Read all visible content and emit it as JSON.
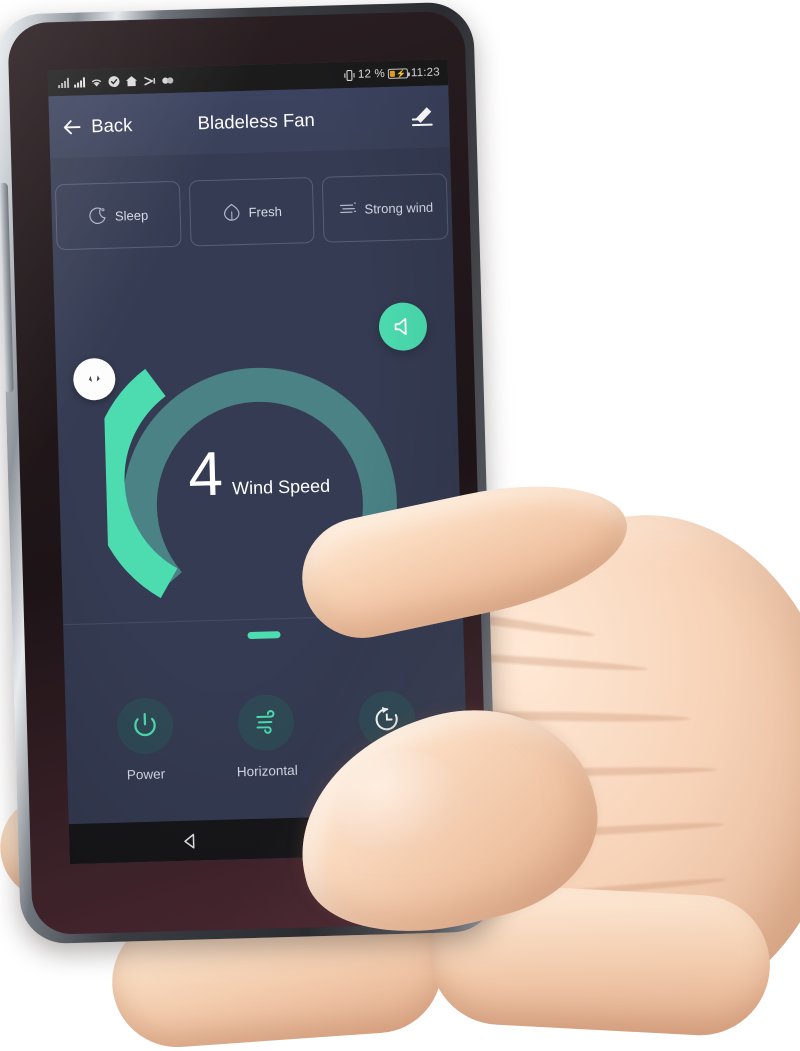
{
  "statusbar": {
    "signal_icon_1": "signal-bars-icon",
    "signal_icon_2": "signal-bars-icon",
    "wifi_icon": "wifi-icon",
    "vpn_icon": "shield-check-icon",
    "home_icon": "home-icon",
    "sync_icon": "sync-arrow-icon",
    "link_icon": "link-icon",
    "vibrate_icon": "vibrate-icon",
    "battery_percent": "12 %",
    "battery_icon": "battery-charging-icon",
    "clock": "11:23"
  },
  "appbar": {
    "back_icon": "arrow-left-icon",
    "back_label": "Back",
    "title": "Bladeless Fan",
    "edit_icon": "pencil-edit-icon"
  },
  "modes": [
    {
      "label": "Sleep",
      "icon": "moon-icon",
      "active": false
    },
    {
      "label": "Fresh",
      "icon": "leaf-icon",
      "active": false
    },
    {
      "label": "Strong wind",
      "icon": "wind-lines-icon",
      "active": false
    }
  ],
  "dial": {
    "value": "4",
    "label": "Wind Speed",
    "min": 1,
    "max": 9,
    "percent_filled": 38,
    "handle_icon": "drag-arrows-icon",
    "track_color": "#4a8285",
    "active_color": "#4cdcb0",
    "speaker_button": {
      "icon": "speaker-mute-icon",
      "color": "#4cdcb0"
    }
  },
  "indicator_pill": {
    "name": "page-indicator",
    "color": "#4cdcb0"
  },
  "controls": [
    {
      "label": "Power",
      "icon": "power-icon",
      "icon_color": "#4cdcb0",
      "active": true
    },
    {
      "label": "Horizontal",
      "icon": "wind-swirl-icon",
      "icon_color": "#4cdcb0",
      "active": true
    },
    {
      "label": "",
      "icon": "timer-clock-icon",
      "icon_color": "#ffffff",
      "active": false
    }
  ],
  "navbar": [
    {
      "icon": "nav-back-triangle-icon"
    },
    {
      "icon": "nav-home-circle-icon"
    }
  ],
  "colors": {
    "screen_bg": "#353b52",
    "appbar_bg": "#3a4159",
    "accent": "#4cdcb0",
    "chip_border": "rgba(167,176,205,0.30)",
    "control_circle": "#2f4a56"
  }
}
